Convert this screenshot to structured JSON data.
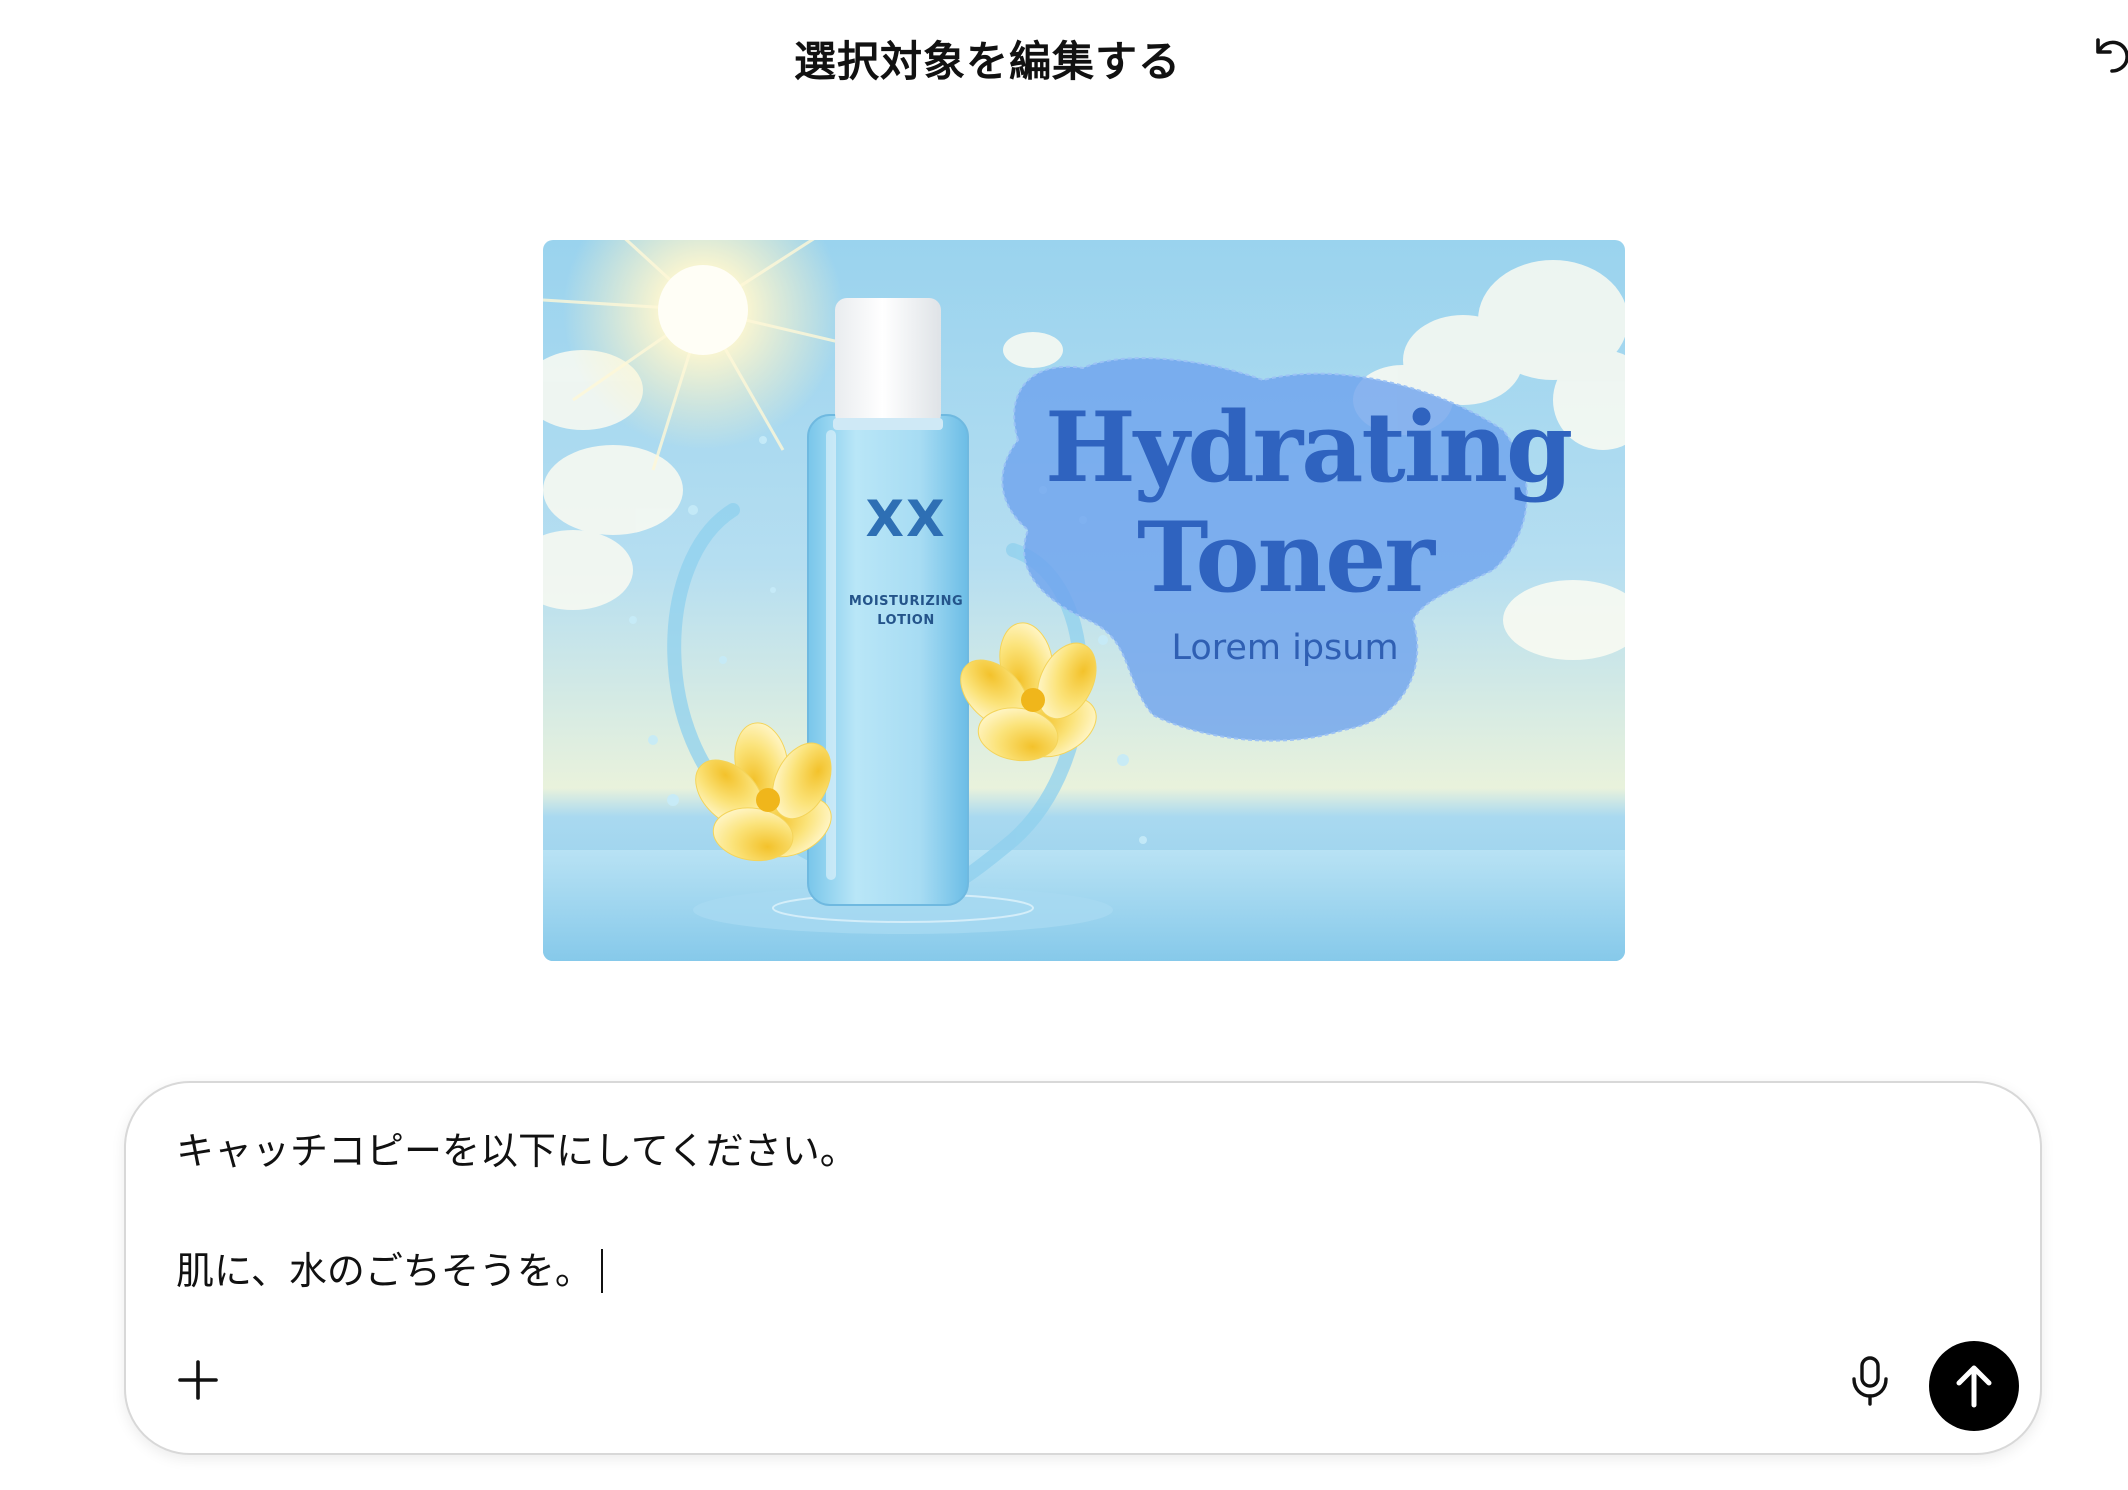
{
  "header": {
    "title": "選択対象を編集する",
    "undo_icon": "undo-icon"
  },
  "ad": {
    "bottle": {
      "brand": "XX",
      "line1": "MOISTURIZING",
      "line2": "LOTION"
    },
    "headline": {
      "line1": "Hydrating",
      "line2": "Toner",
      "sub": "Lorem ipsum"
    },
    "colors": {
      "headline": "#2f63bf",
      "selection": "#6ea3ee"
    }
  },
  "composer": {
    "line1": "キャッチコピーを以下にしてください。",
    "line2": "肌に、水のごちそうを。",
    "plus_icon": "plus-icon",
    "mic_icon": "microphone-icon",
    "send_icon": "arrow-up-icon"
  }
}
